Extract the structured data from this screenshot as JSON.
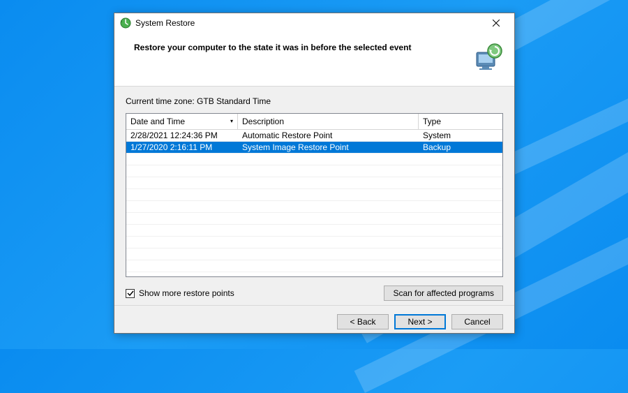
{
  "window": {
    "title": "System Restore"
  },
  "header": {
    "text": "Restore your computer to the state it was in before the selected event"
  },
  "content": {
    "timezone_label": "Current time zone: GTB Standard Time",
    "columns": {
      "date_time": "Date and Time",
      "description": "Description",
      "type": "Type"
    },
    "rows": [
      {
        "date_time": "2/28/2021 12:24:36 PM",
        "description": "Automatic Restore Point",
        "type": "System",
        "selected": false
      },
      {
        "date_time": "1/27/2020 2:16:11 PM",
        "description": "System Image Restore Point",
        "type": "Backup",
        "selected": true
      }
    ],
    "checkbox": {
      "label": "Show more restore points",
      "checked": true
    },
    "scan_button": "Scan for affected programs"
  },
  "footer": {
    "back": "< Back",
    "next": "Next >",
    "cancel": "Cancel"
  }
}
